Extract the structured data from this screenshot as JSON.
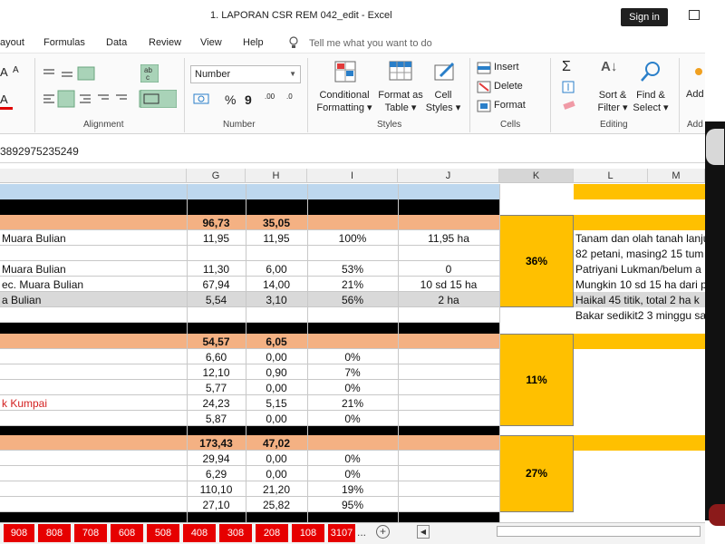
{
  "window": {
    "title": "1. LAPORAN  CSR REM 042_edit  -  Excel",
    "sign_in": "Sign in"
  },
  "menu": [
    "ayout",
    "Formulas",
    "Data",
    "Review",
    "View",
    "Help"
  ],
  "tell_me": "Tell me what you want to do",
  "ribbon": {
    "alignment_label": "Alignment",
    "number_label": "Number",
    "number_format": "Number",
    "styles_label": "Styles",
    "cells_label": "Cells",
    "editing_label": "Editing",
    "add_label": "Add",
    "conditional_formatting": [
      "Conditional",
      "Formatting ▾"
    ],
    "format_as_table": [
      "Format as",
      "Table ▾"
    ],
    "cell_styles": [
      "Cell",
      "Styles ▾"
    ],
    "insert": "Insert",
    "delete": "Delete",
    "format": "Format",
    "sort_filter": [
      "Sort &",
      "Filter ▾"
    ],
    "find_select": [
      "Find &",
      "Select ▾"
    ],
    "add_truncated": "Add",
    "percent": "%",
    "comma": "9",
    "dec_inc": ".00",
    "dec_dec": ".0",
    "font_a": "A"
  },
  "formula_bar": {
    "value": "3892975235249"
  },
  "columns": [
    "G",
    "H",
    "I",
    "J",
    "K",
    "L",
    "M"
  ],
  "rows": [
    {
      "f": "",
      "g": "96,73",
      "h": "35,05",
      "i": "",
      "j": "",
      "l": "",
      "bold": true
    },
    {
      "f": "Muara Bulian",
      "g": "11,95",
      "h": "11,95",
      "i": "100%",
      "j": "11,95 ha",
      "l": "Tanam dan olah tanah lanju"
    },
    {
      "f": "",
      "g": "",
      "h": "",
      "i": "",
      "j": "",
      "l": "82 petani, masing2 15 tum"
    },
    {
      "f": "Muara Bulian",
      "g": "11,30",
      "h": "6,00",
      "i": "53%",
      "j": "0",
      "l": "Patriyani Lukman/belum a"
    },
    {
      "f": "ec. Muara Bulian",
      "g": "67,94",
      "h": "14,00",
      "i": "21%",
      "j": "10 sd 15 ha",
      "l": "Mungkin 10 sd 15 ha dari p"
    },
    {
      "f": "a Bulian",
      "g": "5,54",
      "h": "3,10",
      "i": "56%",
      "j": "2 ha",
      "l": "Haikal 45 titik, total 2 ha k"
    },
    {
      "f": "",
      "g": "",
      "h": "",
      "i": "",
      "j": "",
      "l": "Bakar sedikit2 3 minggu sa"
    },
    {
      "f": "",
      "g": "54,57",
      "h": "6,05",
      "i": "",
      "j": "",
      "l": "",
      "bold": true
    },
    {
      "f": "",
      "g": "6,60",
      "h": "0,00",
      "i": "0%",
      "j": "",
      "l": ""
    },
    {
      "f": "",
      "g": "12,10",
      "h": "0,90",
      "i": "7%",
      "j": "",
      "l": ""
    },
    {
      "f": "",
      "g": "5,77",
      "h": "0,00",
      "i": "0%",
      "j": "",
      "l": ""
    },
    {
      "f": "k Kumpai",
      "g": "24,23",
      "h": "5,15",
      "i": "21%",
      "j": "",
      "l": "",
      "red": true
    },
    {
      "f": "",
      "g": "5,87",
      "h": "0,00",
      "i": "0%",
      "j": "",
      "l": ""
    },
    {
      "f": "",
      "g": "173,43",
      "h": "47,02",
      "i": "",
      "j": "",
      "l": "",
      "bold": true
    },
    {
      "f": "",
      "g": "29,94",
      "h": "0,00",
      "i": "0%",
      "j": "",
      "l": ""
    },
    {
      "f": "",
      "g": "6,29",
      "h": "0,00",
      "i": "0%",
      "j": "",
      "l": ""
    },
    {
      "f": "",
      "g": "110,10",
      "h": "21,20",
      "i": "19%",
      "j": "",
      "l": ""
    },
    {
      "f": "",
      "g": "27,10",
      "h": "25,82",
      "i": "95%",
      "j": "",
      "l": ""
    }
  ],
  "k_percent": [
    "36%",
    "11%",
    "27%"
  ],
  "sheet_tabs": [
    "908",
    "808",
    "708",
    "608",
    "508",
    "408",
    "308",
    "208",
    "108",
    "3107"
  ],
  "tab_overflow": "...",
  "colors": {
    "salmon": "#f4b183",
    "blue_header": "#bdd7ee",
    "orange": "#ffc000",
    "tab_red": "#e60000",
    "selected_row": "#d9d9d9"
  }
}
